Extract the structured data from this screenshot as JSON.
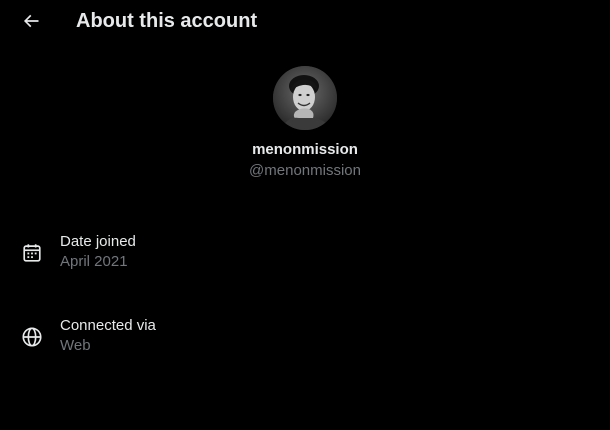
{
  "header": {
    "title": "About this account",
    "back_icon": "arrow-left-icon"
  },
  "profile": {
    "display_name": "menonmission",
    "handle": "@menonmission",
    "avatar": "profile-photo"
  },
  "details": [
    {
      "icon": "calendar-icon",
      "label": "Date joined",
      "value": "April 2021"
    },
    {
      "icon": "globe-icon",
      "label": "Connected via",
      "value": "Web"
    }
  ],
  "colors": {
    "background": "#000000",
    "primary_text": "#e7e9ea",
    "secondary_text": "#71767b"
  }
}
